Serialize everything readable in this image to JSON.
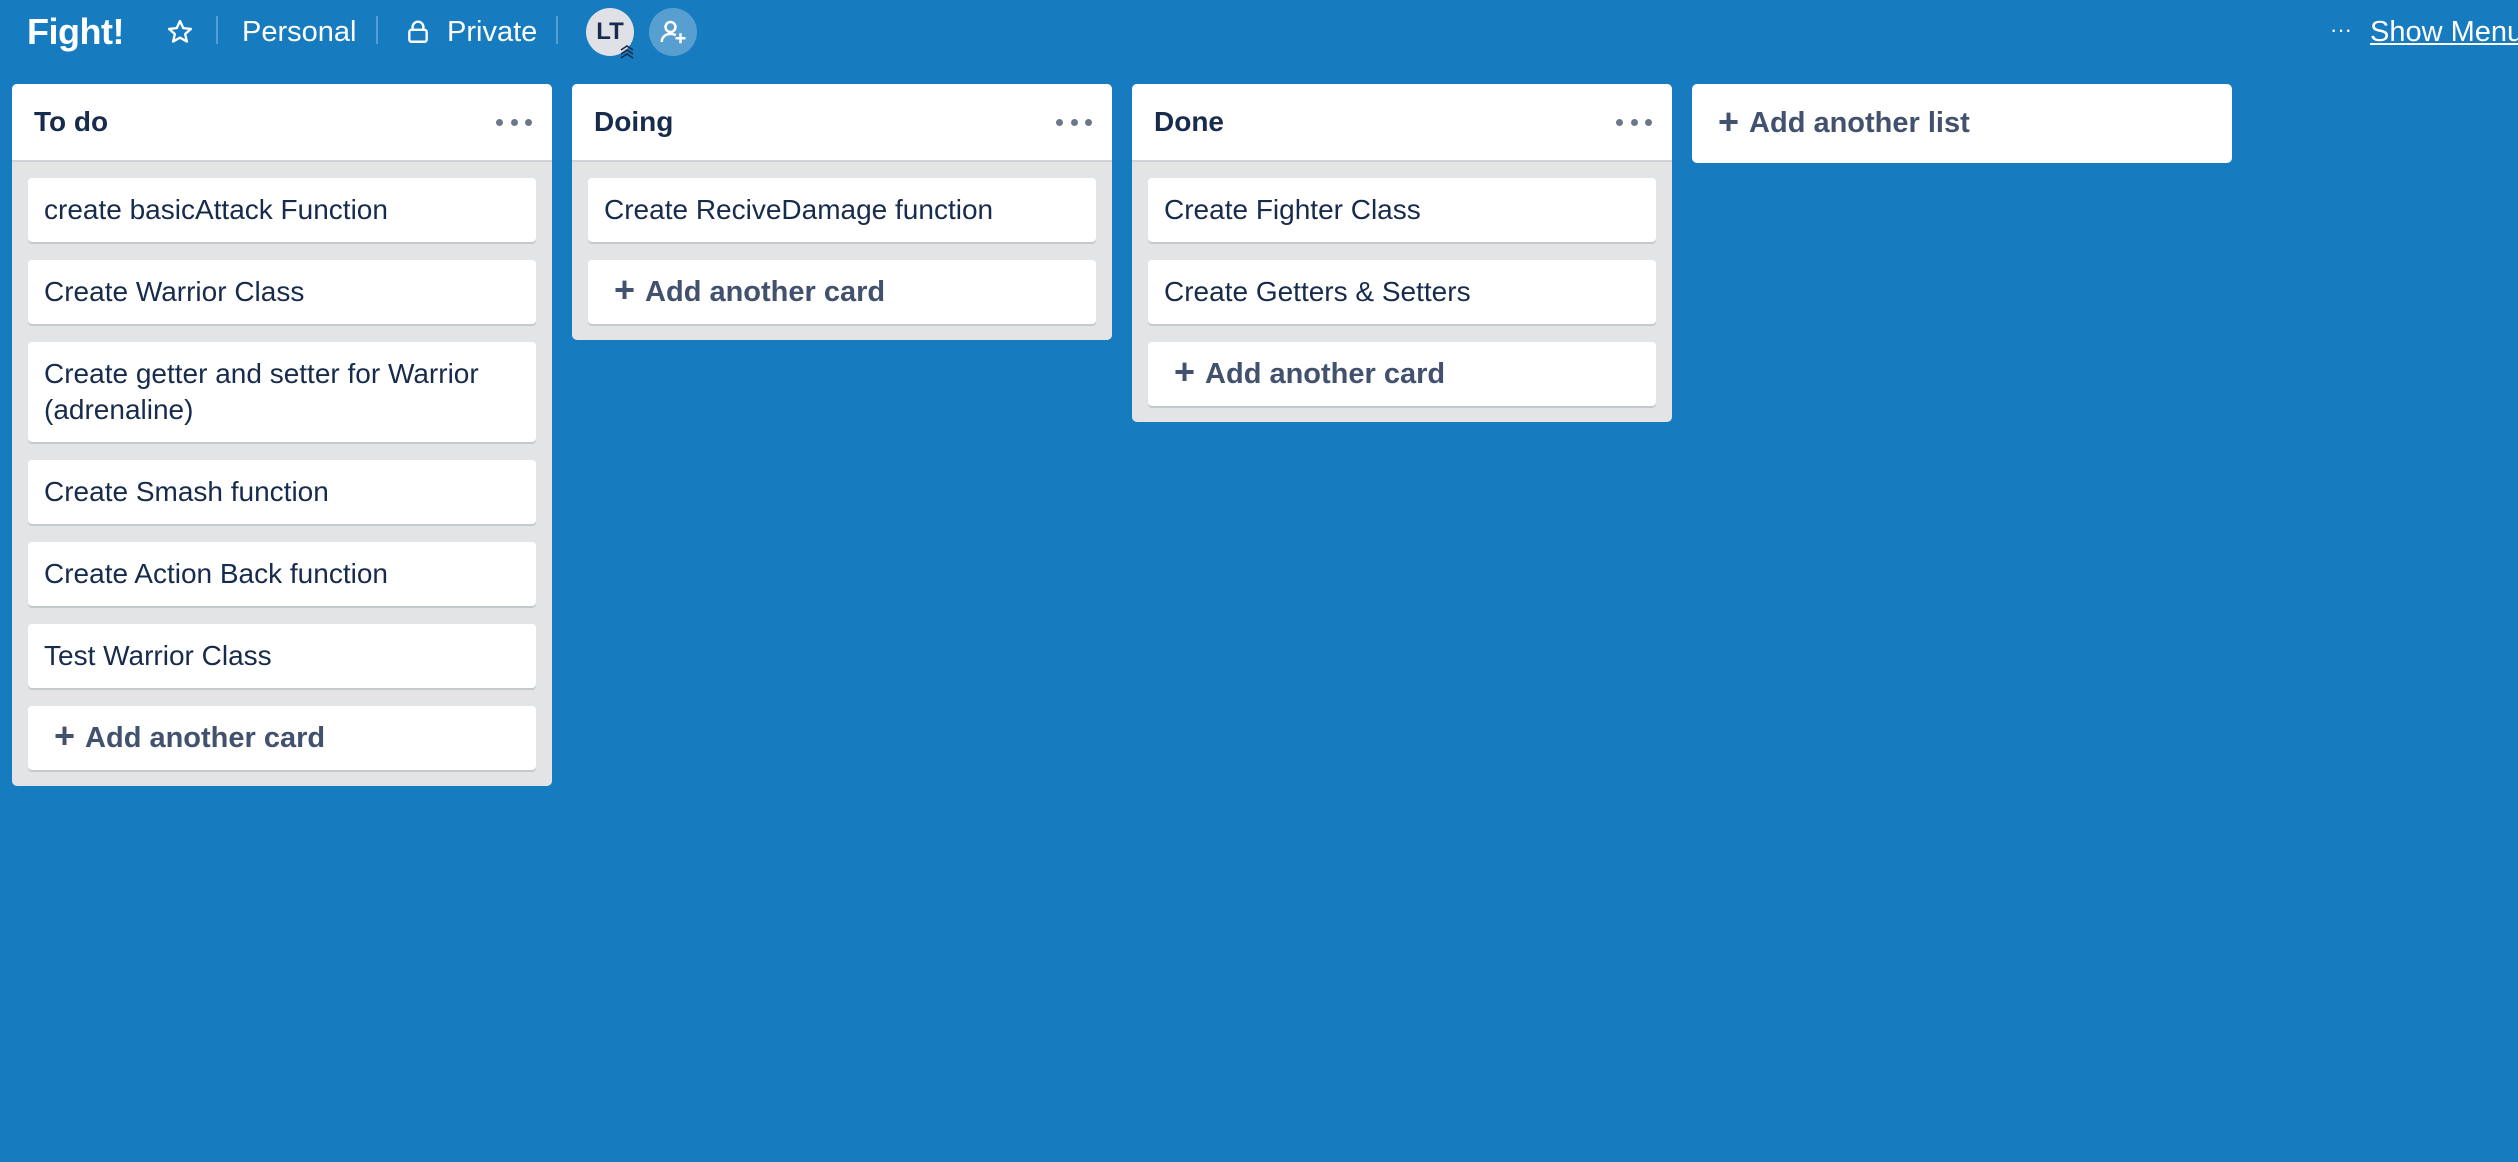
{
  "header": {
    "board_title": "Fight!",
    "team_label": "Personal",
    "visibility_label": "Private",
    "member_initials": "LT",
    "more_glyph": "···",
    "show_menu_label": "Show Menu"
  },
  "lists": [
    {
      "title": "To do",
      "cards": [
        "create basicAttack Function",
        "Create Warrior Class",
        "Create getter and setter for Warrior (adrenaline)",
        "Create Smash function",
        "Create Action Back function",
        "Test Warrior Class"
      ],
      "add_card_label": "Add another card"
    },
    {
      "title": "Doing",
      "cards": [
        "Create ReciveDamage function"
      ],
      "add_card_label": "Add another card"
    },
    {
      "title": "Done",
      "cards": [
        "Create Fighter Class",
        "Create Getters & Setters"
      ],
      "add_card_label": "Add another card"
    }
  ],
  "add_list_label": "Add another list",
  "plus_glyph": "+",
  "icons": {
    "star": "star-icon",
    "lock": "lock-icon",
    "invite": "add-member-icon",
    "more": "more-horizontal-icon"
  },
  "colors": {
    "board_background": "#177bc0",
    "list_background": "#e2e4e6",
    "card_background": "#ffffff",
    "text_primary": "#172b4d"
  }
}
